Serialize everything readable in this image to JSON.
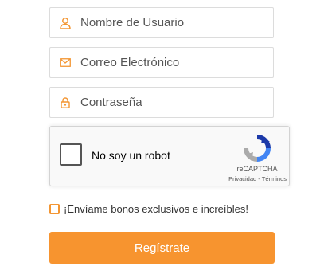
{
  "form": {
    "username": {
      "placeholder": "Nombre de Usuario",
      "icon": "user-icon"
    },
    "email": {
      "placeholder": "Correo Electrónico",
      "icon": "envelope-icon"
    },
    "password": {
      "placeholder": "Contraseña",
      "icon": "lock-icon"
    }
  },
  "recaptcha": {
    "label": "No soy un robot",
    "brand": "reCAPTCHA",
    "privacy": "Privacidad",
    "separator": " - ",
    "terms": "Términos"
  },
  "bonus": {
    "label": "¡Envíame bonos exclusivos e increíbles!",
    "checked": false
  },
  "submit": {
    "label": "Regístrate"
  },
  "colors": {
    "accent": "#f7942f",
    "icon": "#f39633",
    "border": "#dcdcdc"
  }
}
